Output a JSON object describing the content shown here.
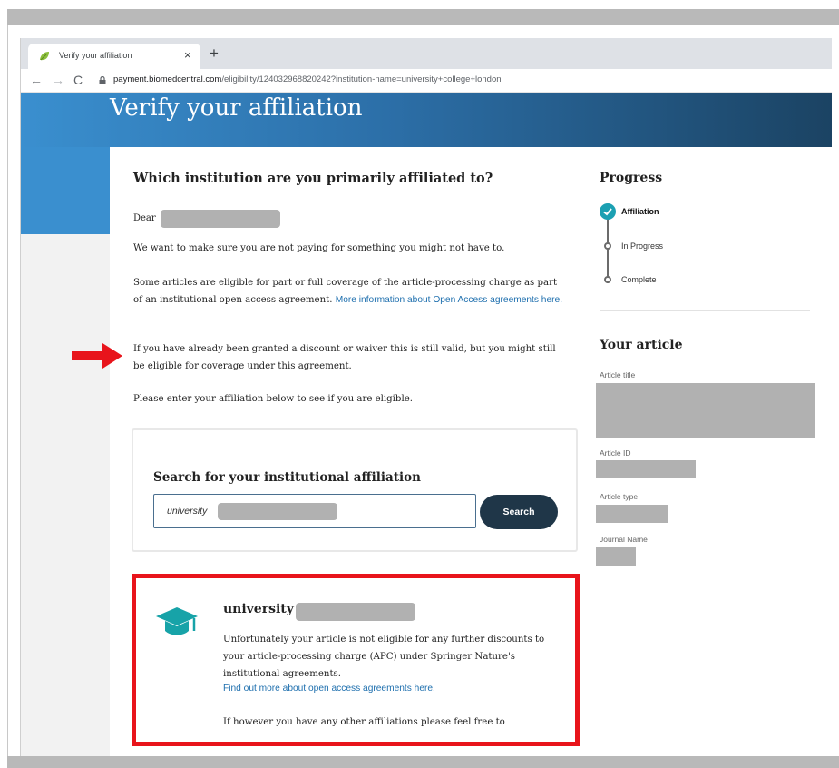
{
  "browser": {
    "tab_title": "Verify your affiliation",
    "close_glyph": "×",
    "new_tab_glyph": "+",
    "back_glyph": "←",
    "forward_glyph": "→",
    "reload_glyph": "C",
    "url_host": "payment.biomedcentral.com",
    "url_path": "/eligibility/124032968820242?institution-name=university+college+london"
  },
  "page": {
    "title": "Verify your affiliation",
    "question": "Which institution are you primarily affiliated to?",
    "dear": "Dear",
    "para1": "We want to make sure you are not paying for something you might not have to.",
    "para2": "Some articles are eligible for part or full coverage of the article-processing charge as part of an institutional open access agreement.",
    "para2_link": "More information about Open Access agreements here.",
    "para3": "If you have already been granted a discount or waiver this is still valid, but you might still be eligible for coverage under this agreement.",
    "para4": "Please enter your affiliation below to see if you are eligible."
  },
  "search": {
    "heading": "Search for your institutional affiliation",
    "value": "university",
    "button": "Search"
  },
  "result": {
    "institution_prefix": "university",
    "text": "Unfortunately your article is not eligible for any further discounts to your article-processing charge (APC) under Springer Nature's institutional agreements.",
    "link": "Find out more about open access agreements here.",
    "more": "If however you have any other affiliations please feel free to"
  },
  "progress": {
    "heading": "Progress",
    "steps": [
      {
        "label": "Affiliation",
        "state": "done"
      },
      {
        "label": "In Progress",
        "state": "pending"
      },
      {
        "label": "Complete",
        "state": "pending"
      }
    ]
  },
  "article": {
    "heading": "Your article",
    "title_label": "Article title",
    "id_label": "Article ID",
    "type_label": "Article type",
    "journal_label": "Journal Name"
  },
  "colors": {
    "accent": "#1ba0b2",
    "highlight_border": "#e8141b",
    "button": "#1f3648",
    "link": "#1e6fae"
  },
  "icons": [
    "leaf-favicon-icon",
    "lock-icon",
    "graduation-cap-icon",
    "check-icon",
    "red-arrow-icon"
  ]
}
